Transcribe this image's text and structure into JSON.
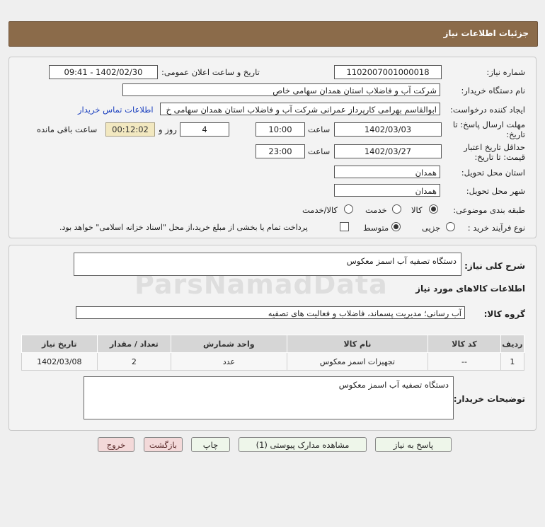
{
  "header": {
    "title": "جزئیات اطلاعات نیاز"
  },
  "form": {
    "need_number_label": "شماره نیاز:",
    "need_number": "1102007001000018",
    "announce_label": "تاریخ و ساعت اعلان عمومی:",
    "announce_value": "1402/02/30 - 09:41",
    "buyer_org_label": "نام دستگاه خریدار:",
    "buyer_org": "شرکت آب و فاضلاب استان همدان سهامی خاص",
    "creator_label": "ایجاد کننده درخواست:",
    "creator": "ابوالقاسم بهرامی کارپرداز عمرانی شرکت آب و فاضلاب استان همدان سهامی خ",
    "contact_link": "اطلاعات تماس خریدار",
    "deadline_label_1": "مهلت ارسال پاسخ: تا",
    "deadline_label_2": "تاریخ:",
    "deadline_date": "1402/03/03",
    "time_word": "ساعت",
    "deadline_time": "10:00",
    "days_value": "4",
    "days_word": "روز و",
    "remaining_time": "00:12:02",
    "remaining_word": "ساعت باقی مانده",
    "validity_label_1": "حداقل تاریخ اعتبار",
    "validity_label_2": "قیمت: تا تاریخ:",
    "validity_date": "1402/03/27",
    "validity_time": "23:00",
    "province_label": "استان محل تحویل:",
    "province": "همدان",
    "city_label": "شهر محل تحویل:",
    "city": "همدان",
    "category_label": "طبقه بندی موضوعی:",
    "category_options": [
      "کالا",
      "خدمت",
      "کالا/خدمت"
    ],
    "category_selected": "کالا",
    "process_label": "نوع فرآیند خرید :",
    "process_options": [
      "جزیی",
      "متوسط"
    ],
    "process_selected": "متوسط",
    "payment_note": "پرداخت تمام یا بخشی از مبلغ خرید،از محل \"اسناد خزانه اسلامی\" خواهد بود."
  },
  "summary": {
    "label": "شرح کلی نیاز:",
    "value": "دستگاه تصفیه آب اسمز معکوس"
  },
  "goods": {
    "section_title": "اطلاعات کالاهای مورد نیاز",
    "group_label": "گروه کالا:",
    "group_value": "آب رسانی؛ مدیریت پسماند، فاضلاب و فعالیت های تصفیه",
    "columns": [
      "ردیف",
      "کد کالا",
      "نام کالا",
      "واحد شمارش",
      "تعداد / مقدار",
      "تاریخ نیاز"
    ],
    "rows": [
      [
        "1",
        "--",
        "تجهیزات اسمز معکوس",
        "عدد",
        "2",
        "1402/03/08"
      ]
    ]
  },
  "buyer_notes": {
    "label": "توضیحات خریدار:",
    "value": "دستگاه تصفیه آب اسمز معکوس"
  },
  "buttons": {
    "reply": "پاسخ به نیاز",
    "attachments": "مشاهده مدارک پیوستی (1)",
    "print": "چاپ",
    "back": "بازگشت",
    "exit": "خروج"
  },
  "watermark": "ParsNamadData"
}
